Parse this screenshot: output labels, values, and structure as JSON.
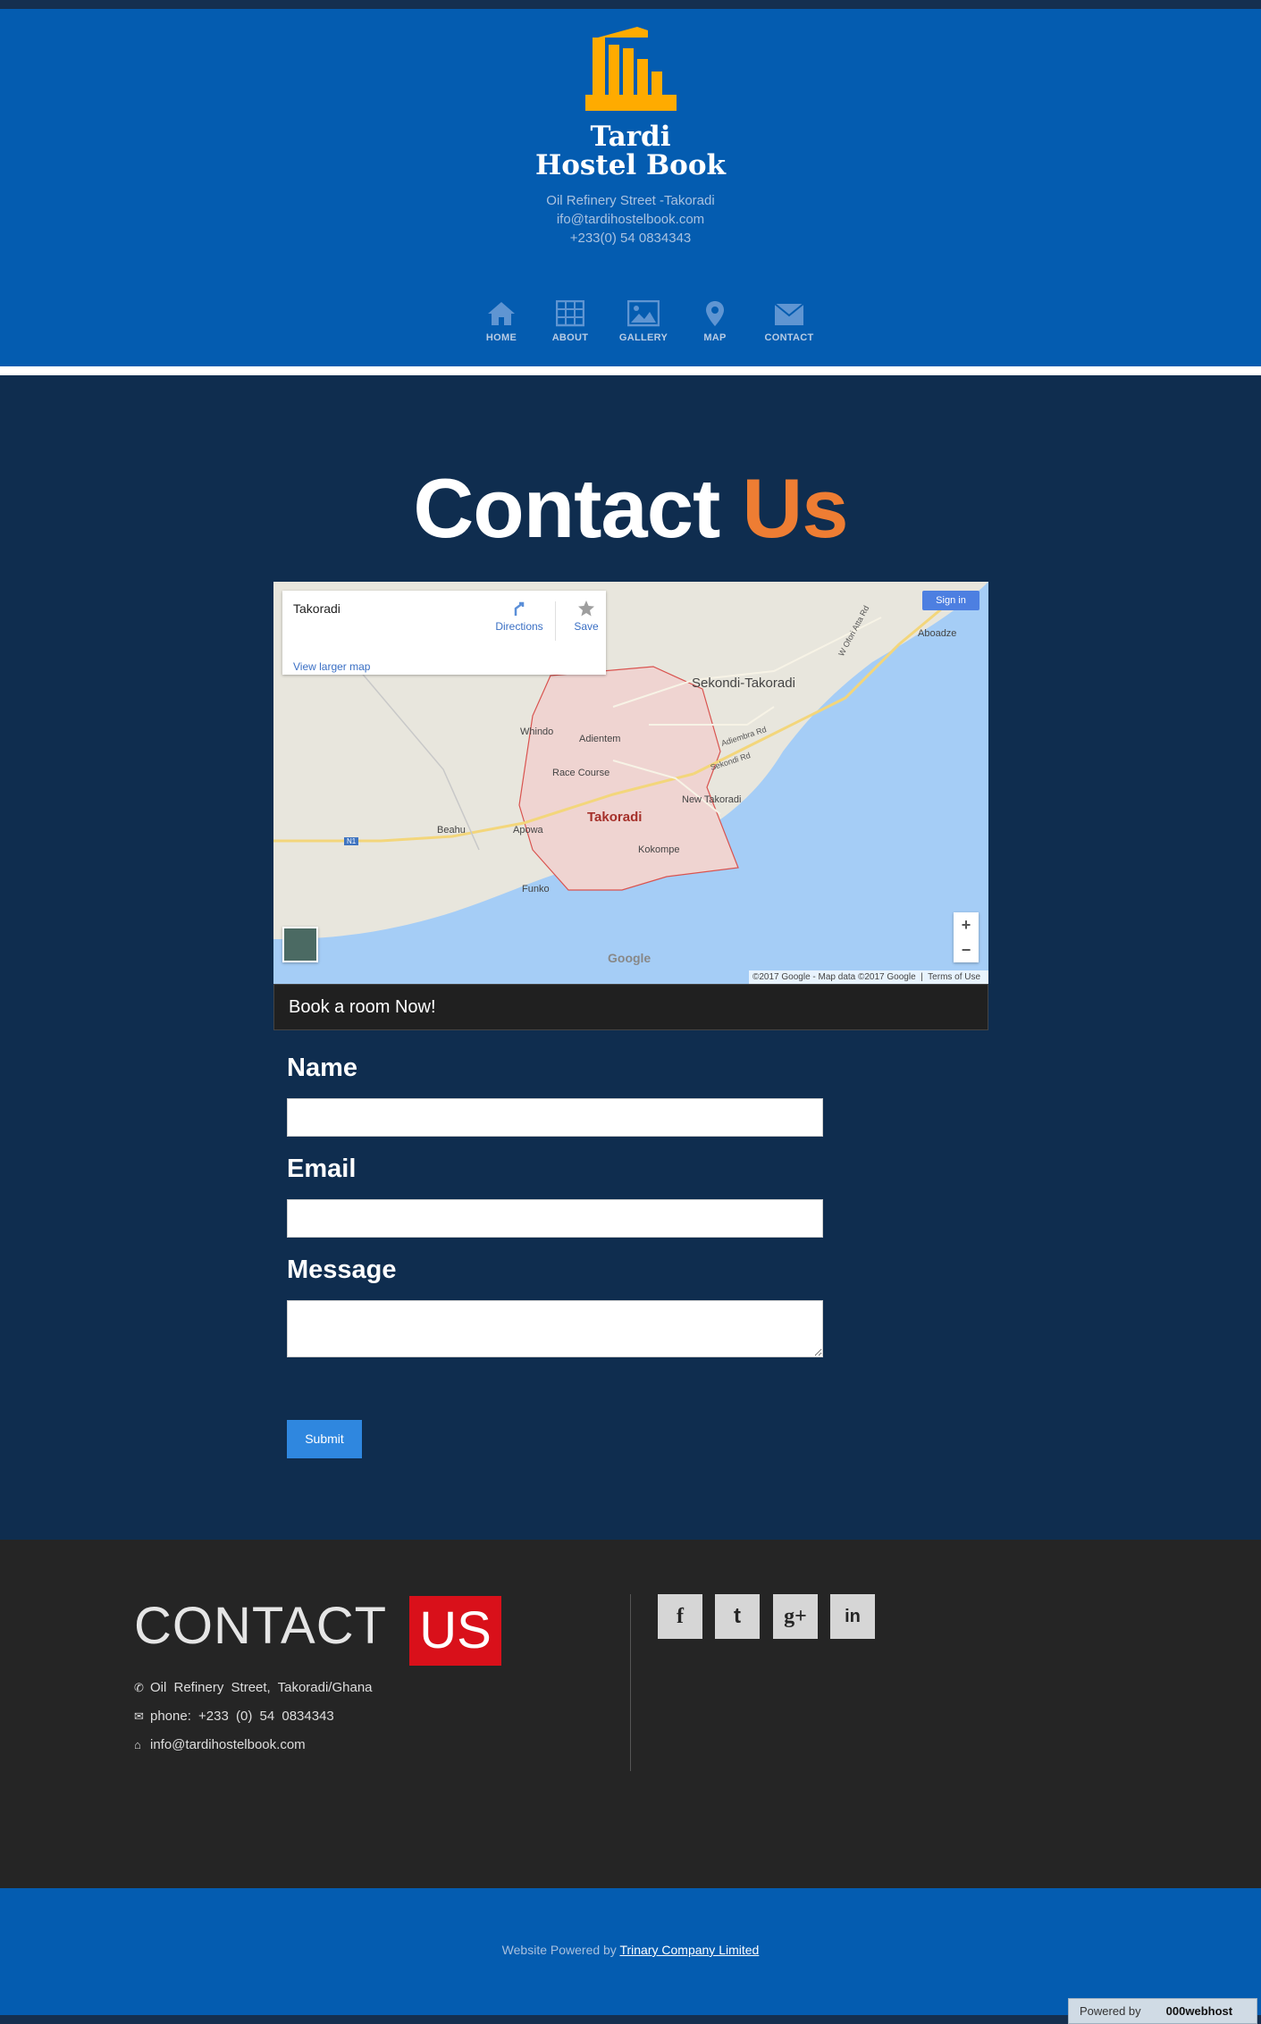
{
  "header": {
    "brand_line1": "Tardi",
    "brand_line2": "Hostel Book",
    "address": "Oil Refinery Street -Takoradi",
    "email": "ifo@tardihostelbook.com",
    "phone": "+233(0) 54 0834343",
    "logo_color": "#ffab00"
  },
  "nav": [
    {
      "label": "HOME",
      "icon": "home-icon"
    },
    {
      "label": "ABOUT",
      "icon": "grid-icon"
    },
    {
      "label": "GALLERY",
      "icon": "image-icon"
    },
    {
      "label": "MAP",
      "icon": "map-pin-icon"
    },
    {
      "label": "CONTACT",
      "icon": "envelope-icon"
    }
  ],
  "page": {
    "title_main": "Contact",
    "title_accent": "Us",
    "accent_color": "#ee7d33"
  },
  "map": {
    "place": "Takoradi",
    "directions": "Directions",
    "save": "Save",
    "view_larger": "View larger map",
    "sign_in": "Sign in",
    "zoom_in": "+",
    "zoom_out": "−",
    "google": "Google",
    "copyright": "©2017 Google - Map data ©2017 Google",
    "terms": "Terms of Use",
    "labels": [
      "Sekondi-Takoradi",
      "Aboadze",
      "Whindo",
      "Adientem",
      "Race Course",
      "New Takoradi",
      "Takoradi",
      "Kokompe",
      "Beahu",
      "Apowa",
      "Funko",
      "Adiembra Rd",
      "Sekondi Rd",
      "W Ofori Atta Rd",
      "N1"
    ]
  },
  "book_bar": "Book a room Now!",
  "form": {
    "name_label": "Name",
    "email_label": "Email",
    "message_label": "Message",
    "submit": "Submit"
  },
  "footer": {
    "title": "CONTACT",
    "title_accent": "US",
    "address": "Oil Refinery Street, Takoradi/Ghana",
    "phone": "phone: +233 (0) 54 0834343",
    "email": "info@tardihostelbook.com",
    "social": [
      {
        "icon": "facebook-icon",
        "glyph": "f"
      },
      {
        "icon": "twitter-icon",
        "glyph": "t"
      },
      {
        "icon": "google-plus-icon",
        "glyph": "g+"
      },
      {
        "icon": "linkedin-icon",
        "glyph": "in"
      }
    ]
  },
  "bottom": {
    "powered_prefix": "Website Powered by",
    "powered_link": "Trinary Company Limited"
  },
  "badge": {
    "prefix": "Powered by",
    "host": "000webhost"
  }
}
